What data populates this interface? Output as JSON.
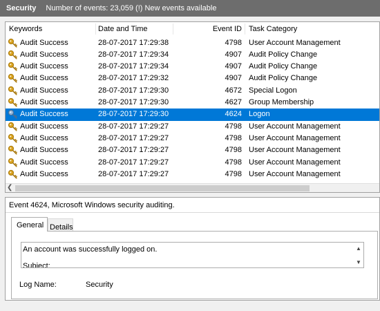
{
  "titlebar": {
    "name": "Security",
    "info": "Number of events: 23,059 (!) New events available"
  },
  "table": {
    "columns": [
      "Keywords",
      "Date and Time",
      "Event ID",
      "Task Category"
    ],
    "rows": [
      {
        "keyword": "Audit Success",
        "date": "28-07-2017 17:29:38",
        "id": "4798",
        "category": "User Account Management"
      },
      {
        "keyword": "Audit Success",
        "date": "28-07-2017 17:29:34",
        "id": "4907",
        "category": "Audit Policy Change"
      },
      {
        "keyword": "Audit Success",
        "date": "28-07-2017 17:29:34",
        "id": "4907",
        "category": "Audit Policy Change"
      },
      {
        "keyword": "Audit Success",
        "date": "28-07-2017 17:29:32",
        "id": "4907",
        "category": "Audit Policy Change"
      },
      {
        "keyword": "Audit Success",
        "date": "28-07-2017 17:29:30",
        "id": "4672",
        "category": "Special Logon"
      },
      {
        "keyword": "Audit Success",
        "date": "28-07-2017 17:29:30",
        "id": "4627",
        "category": "Group Membership"
      },
      {
        "keyword": "Audit Success",
        "date": "28-07-2017 17:29:30",
        "id": "4624",
        "category": "Logon",
        "selected": true
      },
      {
        "keyword": "Audit Success",
        "date": "28-07-2017 17:29:27",
        "id": "4798",
        "category": "User Account Management"
      },
      {
        "keyword": "Audit Success",
        "date": "28-07-2017 17:29:27",
        "id": "4798",
        "category": "User Account Management"
      },
      {
        "keyword": "Audit Success",
        "date": "28-07-2017 17:29:27",
        "id": "4798",
        "category": "User Account Management"
      },
      {
        "keyword": "Audit Success",
        "date": "28-07-2017 17:29:27",
        "id": "4798",
        "category": "User Account Management"
      },
      {
        "keyword": "Audit Success",
        "date": "28-07-2017 17:29:27",
        "id": "4798",
        "category": "User Account Management"
      }
    ],
    "icon": "key-icon",
    "selected_color": "#0078d7"
  },
  "detail": {
    "title": "Event 4624, Microsoft Windows security auditing.",
    "tabs": [
      "General",
      "Details"
    ],
    "description_line1": "An account was successfully logged on.",
    "description_line2": "Subject:",
    "logname_label": "Log Name:",
    "logname_value": "Security"
  }
}
